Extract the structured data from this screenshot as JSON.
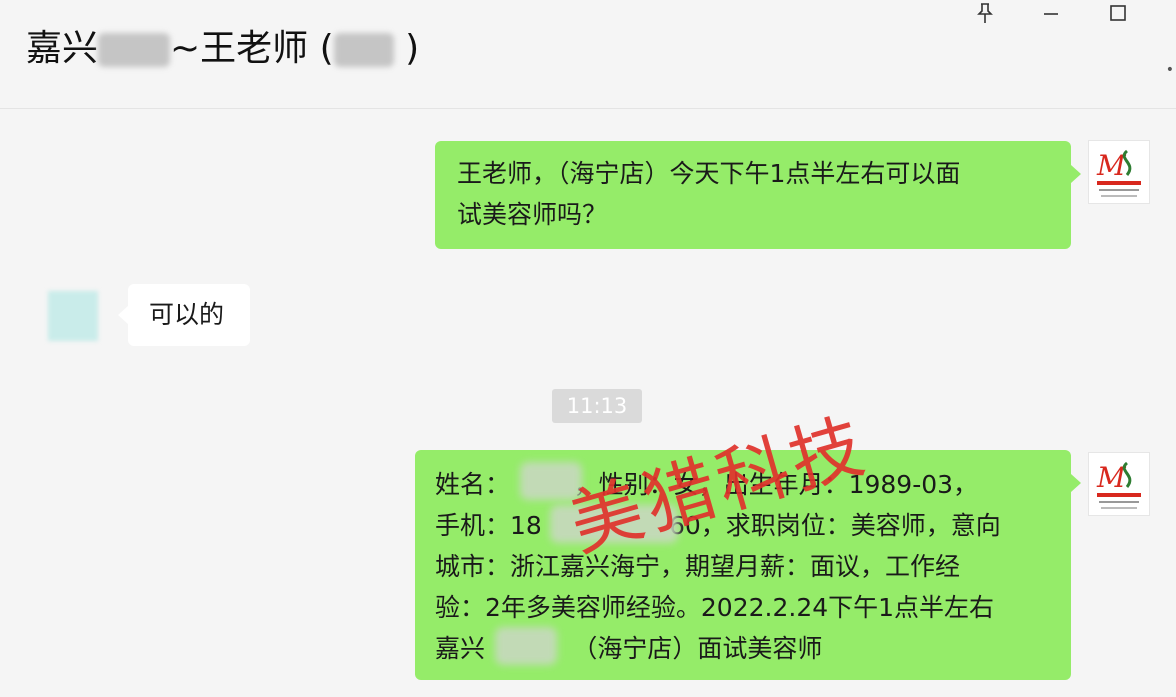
{
  "header": {
    "title_part1": "嘉兴",
    "title_part2": "~王老师 (",
    "title_part3": " )",
    "pin_icon": "pin-icon",
    "minimize_icon": "minimize-icon",
    "maximize_icon": "maximize-icon"
  },
  "messages": [
    {
      "side": "right",
      "text": "王老师，（海宁店）今天下午1点半左右可以面\n试美容师吗？"
    },
    {
      "side": "left",
      "text": "可以的"
    },
    {
      "side": "right",
      "text": "姓名：        ，性别：女，出生年月：1989-03，\n手机：18                60，求职岗位：美容师，意向\n城市：浙江嘉兴海宁，期望月薪：面议，工作经\n验：2年多美容师经验。2022.2.24下午1点半左右\n嘉兴           （海宁店）面试美容师"
    }
  ],
  "timestamp": "11:13",
  "watermark": "美猎科技",
  "colors": {
    "bubble_green": "#95ec69",
    "watermark_red": "#e0322c"
  }
}
